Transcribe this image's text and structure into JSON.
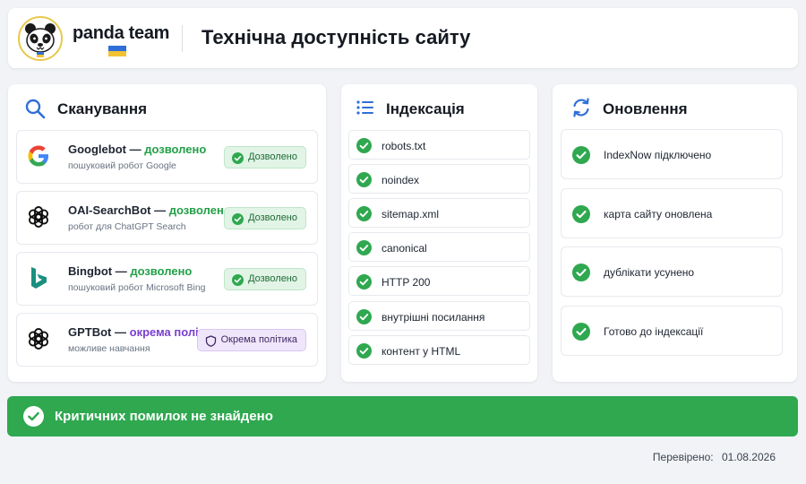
{
  "header": {
    "brand": "panda team",
    "title": "Технічна доступність сайту"
  },
  "colors": {
    "green": "#2fa84f",
    "status_green": "#23a048",
    "status_purple": "#7a3fd0",
    "blue_icon": "#2f6fd6"
  },
  "scan": {
    "title": "Сканування",
    "icon": "search-icon",
    "bots": [
      {
        "name": "Googlebot",
        "sep": " — ",
        "status": "дозволено",
        "status_type": "green",
        "desc": "пошуковий робот Google",
        "badge": "Дозволено",
        "icon": "google-icon"
      },
      {
        "name": "OAI-SearchBot",
        "sep": " — ",
        "status": "дозволено",
        "status_type": "green",
        "desc": "робот для ChatGPT Search",
        "badge": "Дозволено",
        "icon": "openai-icon"
      },
      {
        "name": "Bingbot",
        "sep": " — ",
        "status": "дозволено",
        "status_type": "green",
        "desc": "пошуковий робот Microsoft Bing",
        "badge": "Дозволено",
        "icon": "bing-icon"
      },
      {
        "name": "GPTBot",
        "sep": " — ",
        "status": "окрема політика",
        "status_type": "purple",
        "desc": "можливе навчання",
        "badge": "Окрема політика",
        "icon": "openai-icon"
      }
    ]
  },
  "index": {
    "title": "Індексація",
    "icon": "list-icon",
    "items": [
      "robots.txt",
      "noindex",
      "sitemap.xml",
      "canonical",
      "HTTP 200",
      "внутрішні посилання",
      "контент у HTML"
    ]
  },
  "update": {
    "title": "Оновлення",
    "icon": "refresh-icon",
    "items": [
      "IndexNow підключено",
      "карта сайту оновлена",
      "дублікати усунено",
      "Готово до індексації"
    ]
  },
  "banner": {
    "text": "Критичних помилок не знайдено"
  },
  "footer": {
    "checked_label": "Перевірено:",
    "checked_date": "01.08.2026"
  }
}
